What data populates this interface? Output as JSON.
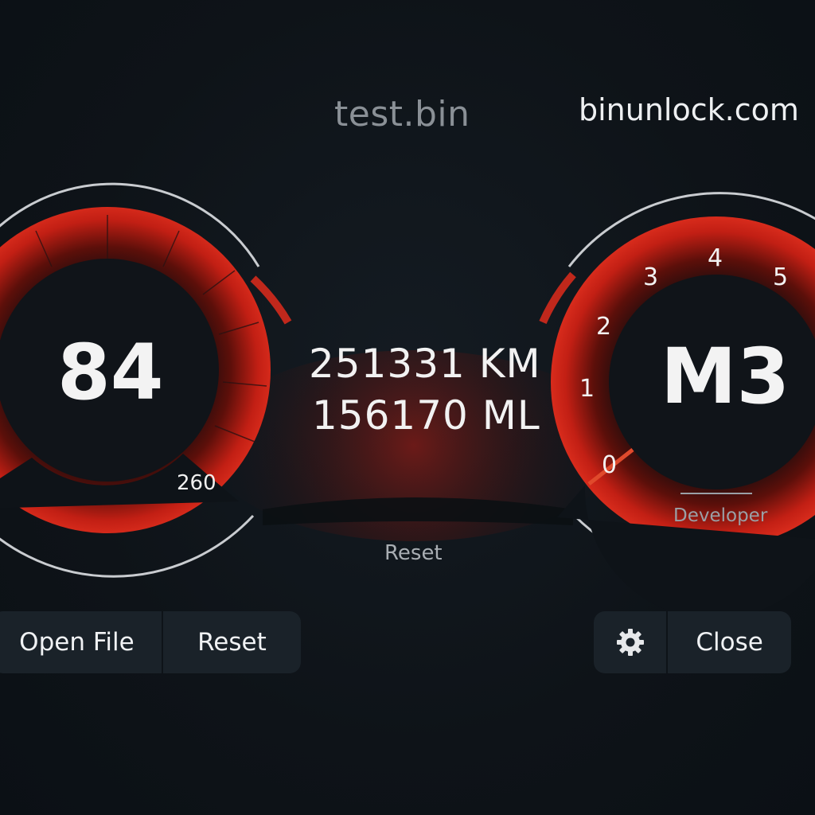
{
  "header": {
    "file_name": "test.bin",
    "site": "binunlock.com"
  },
  "speed_gauge": {
    "value": "84",
    "max_label": "260"
  },
  "odometer": {
    "km": "251331 KM",
    "miles": "156170 ML",
    "reset_label": "Reset"
  },
  "mode_gauge": {
    "value": "M3",
    "scale_labels": [
      "0",
      "1",
      "2",
      "3",
      "4",
      "5"
    ],
    "status_label": "Developer"
  },
  "toolbar_left": {
    "open_label": "Open File",
    "reset_label": "Reset"
  },
  "toolbar_right": {
    "settings_icon": "gear-icon",
    "close_label": "Close"
  },
  "colors": {
    "background": "#0e1318",
    "accent_red": "#d42a1c",
    "ring": "#c9ccd0"
  }
}
